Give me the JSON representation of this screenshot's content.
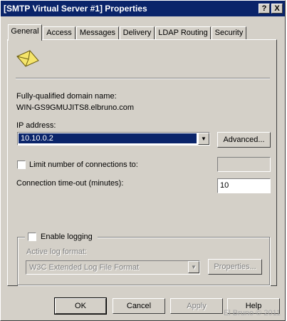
{
  "window": {
    "title": "[SMTP Virtual Server #1] Properties",
    "help_btn": "?",
    "close_btn": "X"
  },
  "tabs": [
    {
      "label": "General",
      "active": true
    },
    {
      "label": "Access",
      "active": false
    },
    {
      "label": "Messages",
      "active": false
    },
    {
      "label": "Delivery",
      "active": false
    },
    {
      "label": "LDAP Routing",
      "active": false
    },
    {
      "label": "Security",
      "active": false
    }
  ],
  "general": {
    "icon": "envelope-icon",
    "fqdn_label": "Fully-qualified domain name:",
    "fqdn_value": "WIN-GS9GMUJITS8.elbruno.com",
    "ip_label": "IP address:",
    "ip_value": "10.10.0.2",
    "advanced_button": "Advanced...",
    "limit_connections_label": "Limit number of connections to:",
    "limit_connections_checked": false,
    "limit_connections_value": "",
    "timeout_label": "Connection time-out (minutes):",
    "timeout_value": "10"
  },
  "logging": {
    "enable_label": "Enable logging",
    "enable_checked": false,
    "format_label": "Active log format:",
    "format_value": "W3C Extended Log File Format",
    "properties_button": "Properties..."
  },
  "buttons": {
    "ok": "OK",
    "cancel": "Cancel",
    "apply": "Apply",
    "help": "Help"
  },
  "watermark": "El Bruno © 2011"
}
